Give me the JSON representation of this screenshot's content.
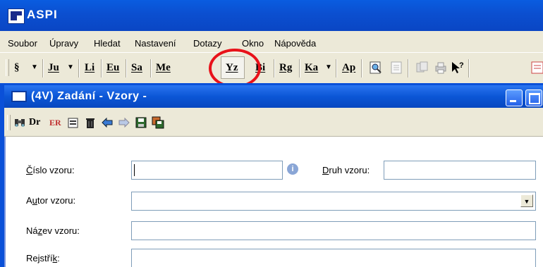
{
  "app": {
    "title": "ASPI"
  },
  "menu": [
    "Soubor",
    "Úpravy",
    "Hledat",
    "Nastavení",
    "Dotazy",
    "Okno",
    "Nápověda"
  ],
  "toolbar": {
    "paragraph": "§",
    "ju": "Ju",
    "li": "Li",
    "eu": "Eu",
    "sa": "Sa",
    "me": "Me",
    "yz": "Yz",
    "bi": "Bi",
    "rg": "Rg",
    "ka": "Ka",
    "ap": "Ap",
    "dropdown": "▼",
    "help": "?"
  },
  "window": {
    "title": "(4V)  Zadání - Vzory -",
    "toolbar": {
      "dr": "Dr",
      "er": "ER"
    }
  },
  "form": {
    "cislo_label_u": "Č",
    "cislo_label_rest": "íslo vzoru:",
    "cislo_value": "",
    "druh_label_u": "D",
    "druh_label_rest": "ruh vzoru:",
    "druh_value": "",
    "autor_label_a": "A",
    "autor_label_u": "u",
    "autor_label_rest": "tor vzoru:",
    "autor_value": "",
    "nazev_label_a": "Ná",
    "nazev_label_u": "z",
    "nazev_label_rest": "ev vzoru:",
    "nazev_value": "",
    "rejstrik_label_a": "Rejstří",
    "rejstrik_label_u": "k",
    "rejstrik_label_rest": ":",
    "rejstrik_value": "",
    "info": "i"
  },
  "colors": {
    "highlight_circle": "#e8121a",
    "titlebar": "#0a50d8"
  }
}
